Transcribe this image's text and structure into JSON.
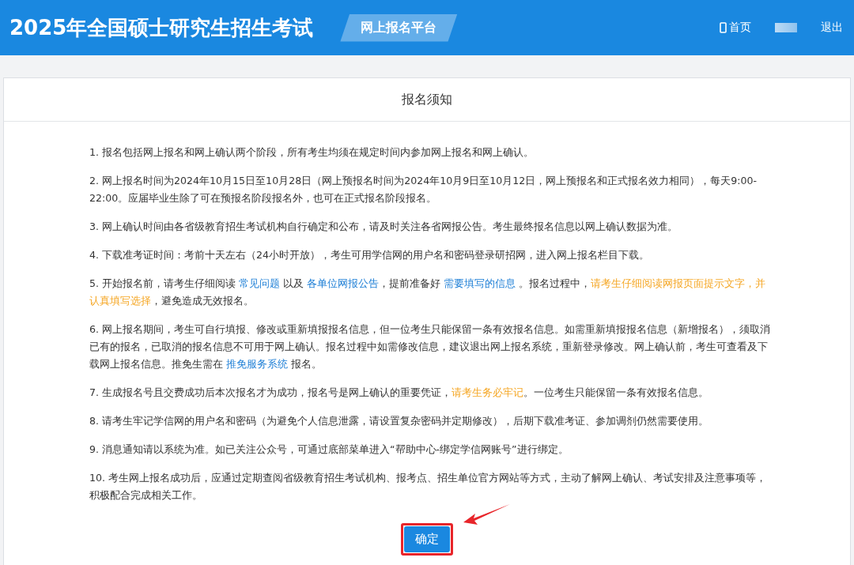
{
  "header": {
    "title": "2025年全国硕士研究生招生考试",
    "badge": "网上报名平台",
    "nav": [
      {
        "kind": "home",
        "label": "首页"
      },
      {
        "kind": "user"
      },
      {
        "kind": "logout",
        "label": "退出"
      }
    ]
  },
  "notice": {
    "title": "报名须知",
    "items": [
      [
        {
          "kind": "text",
          "text": "1. 报名包括网上报名和网上确认两个阶段，所有考生均须在规定时间内参加网上报名和网上确认。"
        }
      ],
      [
        {
          "kind": "text",
          "text": "2. 网上报名时间为2024年10月15日至10月28日（网上预报名时间为2024年10月9日至10月12日，网上预报名和正式报名效力相同），每天9:00-22:00。应届毕业生除了可在预报名阶段报名外，也可在正式报名阶段报名。"
        }
      ],
      [
        {
          "kind": "text",
          "text": "3. 网上确认时间由各省级教育招生考试机构自行确定和公布，请及时关注各省网报公告。考生最终报名信息以网上确认数据为准。"
        }
      ],
      [
        {
          "kind": "text",
          "text": "4. 下载准考证时间：考前十天左右（24小时开放），考生可用学信网的用户名和密码登录研招网，进入网上报名栏目下载。"
        }
      ],
      [
        {
          "kind": "text",
          "text": "5. 开始报名前，请考生仔细阅读 "
        },
        {
          "kind": "link",
          "text": "常见问题"
        },
        {
          "kind": "text",
          "text": " 以及 "
        },
        {
          "kind": "link",
          "text": "各单位网报公告"
        },
        {
          "kind": "text",
          "text": "，提前准备好 "
        },
        {
          "kind": "link",
          "text": "需要填写的信息"
        },
        {
          "kind": "text",
          "text": " 。报名过程中，"
        },
        {
          "kind": "warning",
          "text": "请考生仔细阅读网报页面提示文字，并认真填写选择"
        },
        {
          "kind": "text",
          "text": "，避免造成无效报名。"
        }
      ],
      [
        {
          "kind": "text",
          "text": "6. 网上报名期间，考生可自行填报、修改或重新填报报名信息，但一位考生只能保留一条有效报名信息。如需重新填报报名信息（新增报名），须取消已有的报名，已取消的报名信息不可用于网上确认。报名过程中如需修改信息，建议退出网上报名系统，重新登录修改。网上确认前，考生可查看及下载网上报名信息。推免生需在 "
        },
        {
          "kind": "link",
          "text": "推免服务系统"
        },
        {
          "kind": "text",
          "text": " 报名。"
        }
      ],
      [
        {
          "kind": "text",
          "text": "7. 生成报名号且交费成功后本次报名才为成功，报名号是网上确认的重要凭证，"
        },
        {
          "kind": "warning",
          "text": "请考生务必牢记"
        },
        {
          "kind": "text",
          "text": "。一位考生只能保留一条有效报名信息。"
        }
      ],
      [
        {
          "kind": "text",
          "text": "8. 请考生牢记学信网的用户名和密码（为避免个人信息泄露，请设置复杂密码并定期修改），后期下载准考证、参加调剂仍然需要使用。"
        }
      ],
      [
        {
          "kind": "text",
          "text": "9. 消息通知请以系统为准。如已关注公众号，可通过底部菜单进入“帮助中心-绑定学信网账号”进行绑定。"
        }
      ],
      [
        {
          "kind": "text",
          "text": "10. 考生网上报名成功后，应通过定期查阅省级教育招生考试机构、报考点、招生单位官方网站等方式，主动了解网上确认、考试安排及注意事项等，积极配合完成相关工作。"
        }
      ]
    ],
    "confirm_button": "确定"
  }
}
